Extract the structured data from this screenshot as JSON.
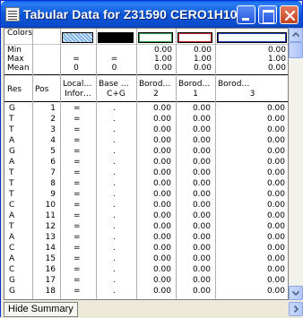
{
  "window": {
    "title": "Tabular Data for Z31590 CERO1H10"
  },
  "summary": {
    "colors_label": "Colors",
    "swatch_colors": [
      "#7fb2e6",
      "#000000",
      "#2a9d46",
      "#c81e28",
      "#1f3fb5"
    ],
    "rows": [
      {
        "label": "Min",
        "values": [
          "",
          "",
          "0.00",
          "0.00",
          "0.00"
        ]
      },
      {
        "label": "Max",
        "values": [
          "=",
          "=",
          "1.00",
          "1.00",
          "1.00"
        ]
      },
      {
        "label": "Mean",
        "values": [
          "0",
          "0",
          "0.00",
          "0.00",
          "0.00"
        ]
      }
    ]
  },
  "columns": [
    {
      "line1": "Res",
      "line2": ""
    },
    {
      "line1": "Pos",
      "line2": ""
    },
    {
      "line1": "Local…",
      "line2": "Infor…"
    },
    {
      "line1": "Base …",
      "line2": "C+G"
    },
    {
      "line1": "Borod…",
      "line2": "2"
    },
    {
      "line1": "Borod…",
      "line2": "1"
    },
    {
      "line1": "Borod…",
      "line2": "3"
    }
  ],
  "rows": [
    [
      "G",
      "1",
      "=",
      ".",
      "0.00",
      "0.00",
      "0.00"
    ],
    [
      "T",
      "2",
      "=",
      ".",
      "0.00",
      "0.00",
      "0.00"
    ],
    [
      "T",
      "3",
      "=",
      ".",
      "0.00",
      "0.00",
      "0.00"
    ],
    [
      "A",
      "4",
      "=",
      ".",
      "0.00",
      "0.00",
      "0.00"
    ],
    [
      "G",
      "5",
      "=",
      ".",
      "0.00",
      "0.00",
      "0.00"
    ],
    [
      "A",
      "6",
      "=",
      ".",
      "0.00",
      "0.00",
      "0.00"
    ],
    [
      "T",
      "7",
      "=",
      ".",
      "0.00",
      "0.00",
      "0.00"
    ],
    [
      "T",
      "8",
      "=",
      ".",
      "0.00",
      "0.00",
      "0.00"
    ],
    [
      "T",
      "9",
      "=",
      ".",
      "0.00",
      "0.00",
      "0.00"
    ],
    [
      "C",
      "10",
      "=",
      ".",
      "0.00",
      "0.00",
      "0.00"
    ],
    [
      "A",
      "11",
      "=",
      ".",
      "0.00",
      "0.00",
      "0.00"
    ],
    [
      "T",
      "12",
      "=",
      ".",
      "0.00",
      "0.00",
      "0.00"
    ],
    [
      "A",
      "13",
      "=",
      ".",
      "0.00",
      "0.00",
      "0.00"
    ],
    [
      "C",
      "14",
      "=",
      ".",
      "0.00",
      "0.00",
      "0.00"
    ],
    [
      "A",
      "15",
      "=",
      ".",
      "0.00",
      "0.00",
      "0.00"
    ],
    [
      "C",
      "16",
      "=",
      ".",
      "0.00",
      "0.00",
      "0.00"
    ],
    [
      "G",
      "17",
      "=",
      ".",
      "0.00",
      "0.00",
      "0.00"
    ],
    [
      "G",
      "18",
      "=",
      ".",
      "0.00",
      "0.00",
      "0.00"
    ]
  ],
  "footer": {
    "hide_summary_label": "Hide Summary"
  }
}
